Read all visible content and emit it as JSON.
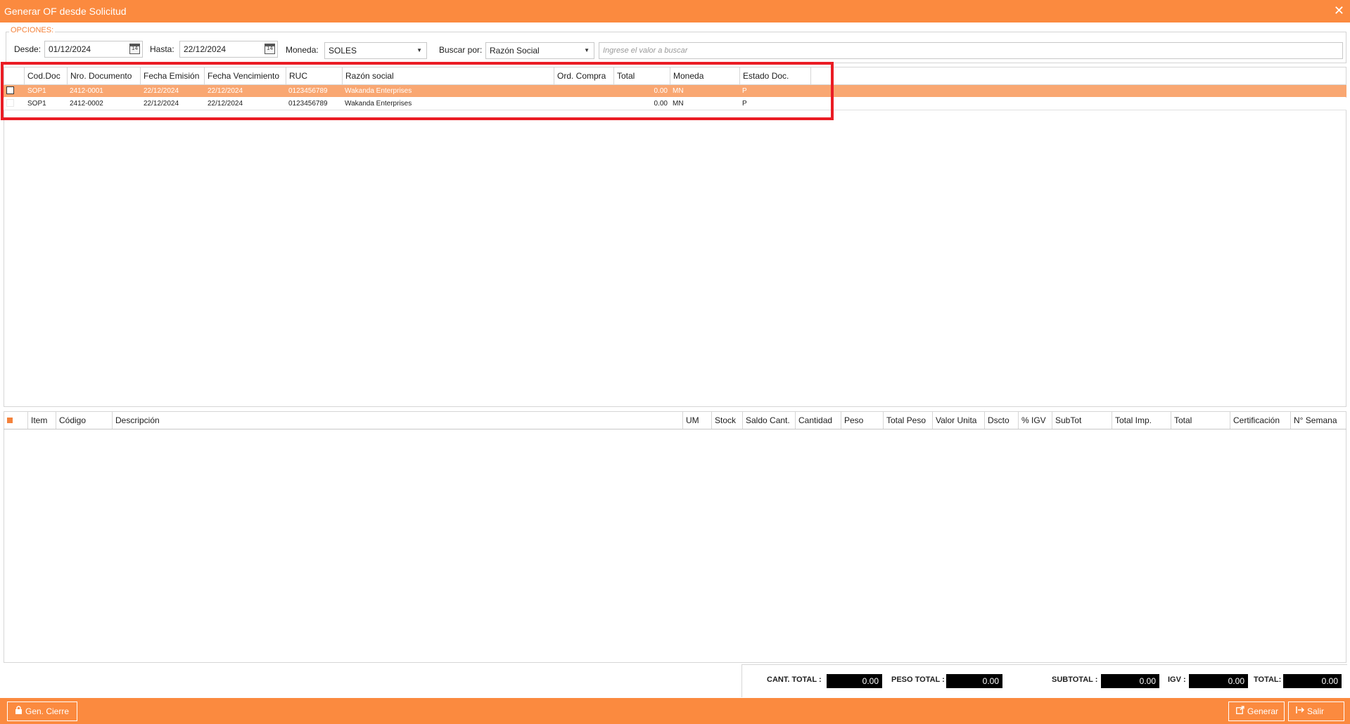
{
  "window": {
    "title": "Generar OF desde Solicitud",
    "close_glyph": "✕"
  },
  "options": {
    "legend": "OPCIONES:",
    "desde_label": "Desde:",
    "desde_value": "01/12/2024",
    "hasta_label": "Hasta:",
    "hasta_value": "22/12/2024",
    "calendar_icon_text": "14",
    "moneda_label": "Moneda:",
    "moneda_value": "SOLES",
    "buscar_label": "Buscar por:",
    "buscar_value": "Razón Social",
    "search_placeholder": "Ingrese el valor a buscar"
  },
  "documents": {
    "columns": [
      "Cod.Doc",
      "Nro. Documento",
      "Fecha Emisión",
      "Fecha Vencimiento",
      "RUC",
      "Razón social",
      "Ord. Compra",
      "Total",
      "Moneda",
      "Estado Doc."
    ],
    "rows": [
      {
        "cod": "SOP1",
        "nro": "2412-0001",
        "emision": "22/12/2024",
        "vencimiento": "22/12/2024",
        "ruc": "0123456789",
        "razon": "Wakanda Enterprises",
        "orden": "",
        "total": "0.00",
        "moneda": "MN",
        "estado": "P",
        "selected": true
      },
      {
        "cod": "SOP1",
        "nro": "2412-0002",
        "emision": "22/12/2024",
        "vencimiento": "22/12/2024",
        "ruc": "0123456789",
        "razon": "Wakanda Enterprises",
        "orden": "",
        "total": "0.00",
        "moneda": "MN",
        "estado": "P",
        "selected": false
      }
    ]
  },
  "details": {
    "columns": [
      "Item",
      "Código",
      "Descripción",
      "UM",
      "Stock",
      "Saldo Cant.",
      "Cantidad",
      "Peso",
      "Total Peso",
      "Valor Unita",
      "Dscto",
      "% IGV",
      "SubTot",
      "Total Imp.",
      "Total",
      "Certificación",
      "N° Semana"
    ]
  },
  "totals": {
    "cant_label": "CANT. TOTAL :",
    "cant_value": "0.00",
    "peso_label": "PESO TOTAL :",
    "peso_value": "0.00",
    "subtotal_label": "SUBTOTAL :",
    "subtotal_value": "0.00",
    "igv_label": "IGV :",
    "igv_value": "0.00",
    "total_label": "TOTAL:",
    "total_value": "0.00"
  },
  "footer": {
    "gen_cierre": "Gen. Cierre",
    "generar": "Generar",
    "salir": "Salir"
  },
  "colors": {
    "accent": "#fb8a3f",
    "selected_row": "#f9a772",
    "highlight": "#ea1c24"
  }
}
